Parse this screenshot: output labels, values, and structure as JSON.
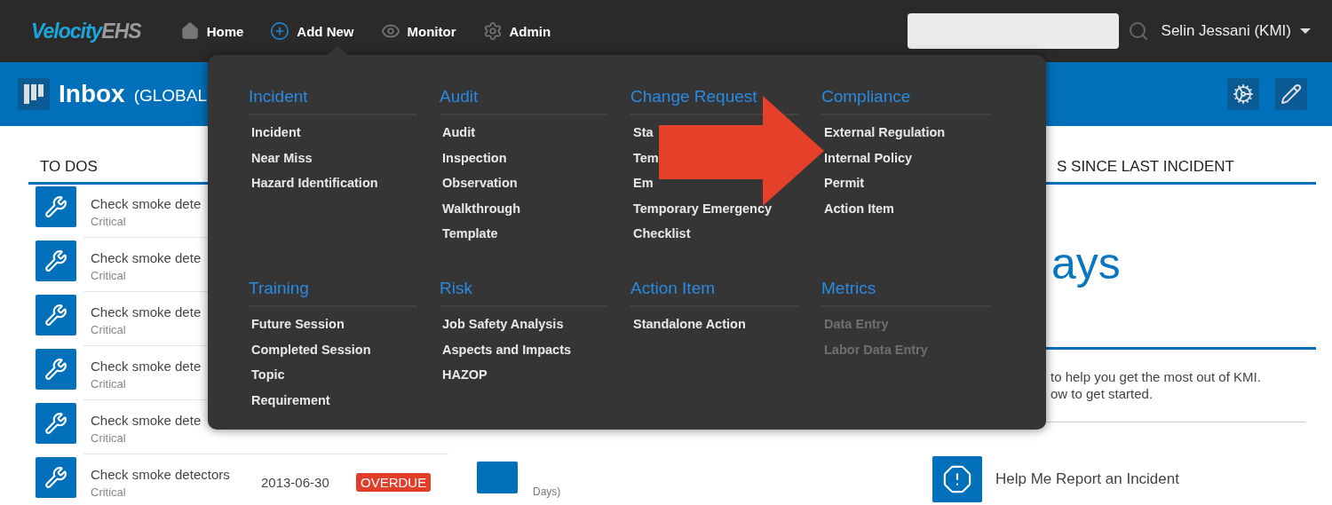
{
  "nav": {
    "logo": {
      "brand": "Velocity",
      "suffix": "EHS"
    },
    "items": [
      {
        "label": "Home",
        "selected": false
      },
      {
        "label": "Add New",
        "selected": true
      },
      {
        "label": "Monitor",
        "selected": false
      },
      {
        "label": "Admin",
        "selected": false
      }
    ],
    "user": "Selin Jessani (KMI)"
  },
  "header": {
    "title": "Inbox",
    "scope": "(GLOBAL"
  },
  "todos": {
    "title": "TO DOS",
    "items": [
      {
        "title": "Check smoke dete",
        "priority": "Critical"
      },
      {
        "title": "Check smoke dete",
        "priority": "Critical"
      },
      {
        "title": "Check smoke dete",
        "priority": "Critical"
      },
      {
        "title": "Check smoke dete",
        "priority": "Critical"
      },
      {
        "title": "Check smoke dete",
        "priority": "Critical"
      },
      {
        "title": "Check smoke detectors",
        "priority": "Critical",
        "date": "2013-06-30",
        "status": "OVERDUE"
      }
    ]
  },
  "middle": {
    "note": "Days)"
  },
  "stats": {
    "title": "S SINCE LAST INCIDENT",
    "value": "ays"
  },
  "help": {
    "lines": [
      "to help you get the most out of KMI.",
      "ow to get started."
    ],
    "actions": [
      {
        "label": "Help Me Report an Incident"
      }
    ]
  },
  "add_new_menu": {
    "sections": [
      {
        "title": "Incident",
        "items": [
          {
            "label": "Incident",
            "disabled": false
          },
          {
            "label": "Near Miss",
            "disabled": false
          },
          {
            "label": "Hazard Identification",
            "disabled": false
          }
        ]
      },
      {
        "title": "Audit",
        "items": [
          {
            "label": "Audit",
            "disabled": false
          },
          {
            "label": "Inspection",
            "disabled": false
          },
          {
            "label": "Observation",
            "disabled": false
          },
          {
            "label": "Walkthrough",
            "disabled": false
          },
          {
            "label": "Template",
            "disabled": false
          }
        ]
      },
      {
        "title": "Change Request",
        "items": [
          {
            "label": "Sta",
            "disabled": false
          },
          {
            "label": "Tem",
            "disabled": false
          },
          {
            "label": "Em",
            "disabled": false
          },
          {
            "label": "Temporary Emergency",
            "disabled": false
          },
          {
            "label": "Checklist",
            "disabled": false
          }
        ]
      },
      {
        "title": "Compliance",
        "items": [
          {
            "label": "External Regulation",
            "disabled": false
          },
          {
            "label": "Internal Policy",
            "disabled": false
          },
          {
            "label": "Permit",
            "disabled": false
          },
          {
            "label": "Action Item",
            "disabled": false
          }
        ]
      },
      {
        "title": "Training",
        "items": [
          {
            "label": "Future Session",
            "disabled": false
          },
          {
            "label": "Completed Session",
            "disabled": false
          },
          {
            "label": "Topic",
            "disabled": false
          },
          {
            "label": "Requirement",
            "disabled": false
          }
        ]
      },
      {
        "title": "Risk",
        "items": [
          {
            "label": "Job Safety Analysis",
            "disabled": false
          },
          {
            "label": "Aspects and Impacts",
            "disabled": false
          },
          {
            "label": "HAZOP",
            "disabled": false
          }
        ]
      },
      {
        "title": "Action Item",
        "items": [
          {
            "label": "Standalone Action",
            "disabled": false
          }
        ]
      },
      {
        "title": "Metrics",
        "items": [
          {
            "label": "Data Entry",
            "disabled": true
          },
          {
            "label": "Labor Data Entry",
            "disabled": true
          }
        ]
      }
    ]
  }
}
